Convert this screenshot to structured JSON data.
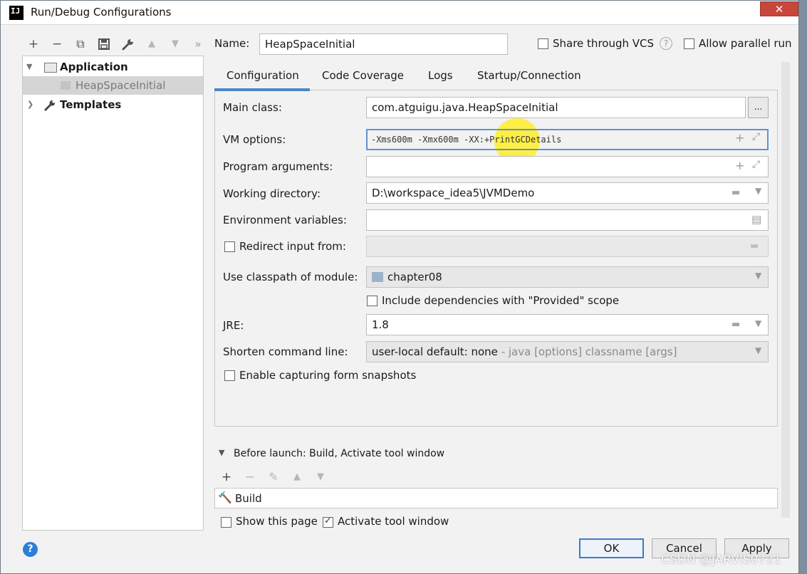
{
  "window": {
    "title": "Run/Debug Configurations",
    "app_icon": "IJ",
    "close_label": "✕"
  },
  "toolbar": {
    "add": "+",
    "remove": "−",
    "copy": "⧉",
    "save": "💾",
    "edit_defaults": "🔧",
    "move_up": "▲",
    "move_down": "▼",
    "more": "»"
  },
  "tree": {
    "items": [
      {
        "label": "Application",
        "expanded": true
      },
      {
        "label": "HeapSpaceInitial",
        "selected": true
      },
      {
        "label": "Templates",
        "expanded": false
      }
    ]
  },
  "header": {
    "name_label": "Name:",
    "name_value": "HeapSpaceInitial",
    "share_vcs_label": "Share through VCS",
    "share_vcs_checked": false,
    "help_glyph": "?",
    "allow_parallel_label": "Allow parallel run",
    "allow_parallel_checked": false
  },
  "tabs": [
    {
      "label": "Configuration",
      "active": true
    },
    {
      "label": "Code Coverage"
    },
    {
      "label": "Logs"
    },
    {
      "label": "Startup/Connection"
    }
  ],
  "config": {
    "main_class_label": "Main class:",
    "main_class_value": "com.atguigu.java.HeapSpaceInitial",
    "browse_label": "...",
    "vm_options_label": "VM options:",
    "vm_options_value": "-Xms600m -Xmx600m -XX:+PrintGCDetails",
    "program_args_label": "Program arguments:",
    "program_args_value": "",
    "working_dir_label": "Working directory:",
    "working_dir_value": "D:\\workspace_idea5\\JVMDemo",
    "env_vars_label": "Environment variables:",
    "env_vars_value": "",
    "redirect_label": "Redirect input from:",
    "redirect_checked": false,
    "classpath_label": "Use classpath of module:",
    "classpath_value": "chapter08",
    "include_deps_label": "Include dependencies with \"Provided\" scope",
    "include_deps_checked": false,
    "jre_label": "JRE:",
    "jre_value": "1.8",
    "shorten_label": "Shorten command line:",
    "shorten_value": "user-local default: none",
    "shorten_hint": " - java [options] classname [args]",
    "snapshots_label": "Enable capturing form snapshots",
    "snapshots_checked": false
  },
  "before_launch": {
    "header": "Before launch: Build, Activate tool window",
    "add": "+",
    "remove": "−",
    "edit": "✎",
    "up": "▲",
    "down": "▼",
    "task": "Build",
    "show_page_label": "Show this page",
    "show_page_checked": false,
    "activate_label": "Activate tool window",
    "activate_checked": true
  },
  "buttons": {
    "ok": "OK",
    "cancel": "Cancel",
    "apply": "Apply",
    "help": "?"
  },
  "watermark": "CSDN @JARVIS0721",
  "colors": {
    "accent": "#4a86c8",
    "close": "#c9463d",
    "highlight": "#ffee28",
    "help": "#2d7fd6"
  }
}
